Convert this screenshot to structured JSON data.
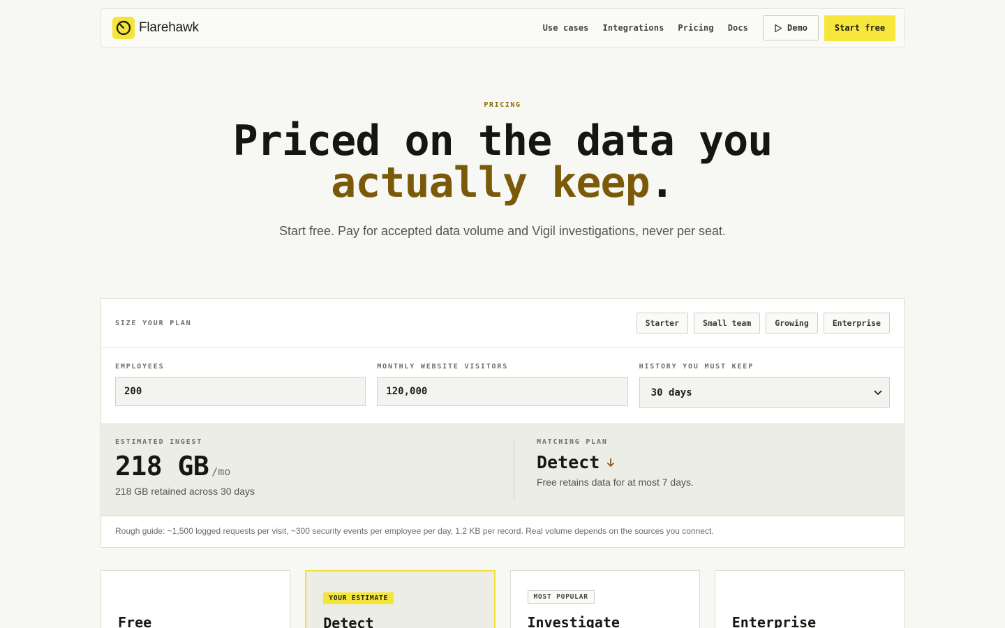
{
  "brand": {
    "name": "Flarehawk",
    "accent": "#f5e43a"
  },
  "nav": {
    "links": [
      "Use cases",
      "Integrations",
      "Pricing",
      "Docs"
    ],
    "demo_label": "Demo",
    "start_label": "Start free"
  },
  "hero": {
    "eyebrow": "PRICING",
    "title_line1": "Priced on the data you",
    "title_accent": "actually keep",
    "title_end": ".",
    "subtitle": "Start free. Pay for accepted data volume and Vigil investigations, never per seat."
  },
  "calculator": {
    "heading": "SIZE YOUR PLAN",
    "presets": [
      "Starter",
      "Small team",
      "Growing",
      "Enterprise"
    ],
    "fields": {
      "employees": {
        "label": "EMPLOYEES",
        "value": "200"
      },
      "visitors": {
        "label": "MONTHLY WEBSITE VISITORS",
        "value": "120,000"
      },
      "history": {
        "label": "HISTORY YOU MUST KEEP",
        "value": "30 days"
      }
    },
    "estimate": {
      "label": "ESTIMATED INGEST",
      "value": "218 GB",
      "unit": "/mo",
      "note": "218 GB retained across 30 days"
    },
    "plan": {
      "label": "MATCHING PLAN",
      "name": "Detect",
      "note": "Free retains data for at most 7 days."
    },
    "footnote": "Rough guide: ~1,500 logged requests per visit, ~300 security events per employee per day, 1.2 KB per record. Real volume depends on the sources you connect."
  },
  "plans": [
    {
      "name": "Free",
      "badge": ""
    },
    {
      "name": "Detect",
      "badge": "YOUR ESTIMATE"
    },
    {
      "name": "Investigate",
      "badge": "MOST POPULAR"
    },
    {
      "name": "Enterprise",
      "badge": ""
    }
  ]
}
